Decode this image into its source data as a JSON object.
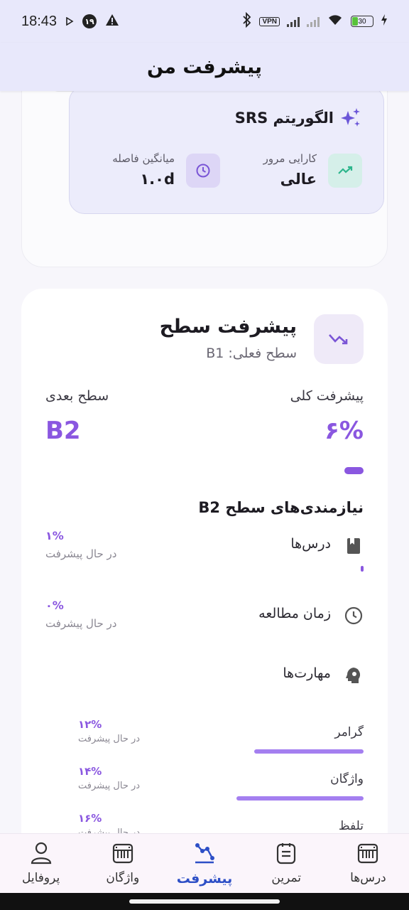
{
  "status_bar": {
    "time": "18:43",
    "notification_badge": "۱۹",
    "vpn": "VPN",
    "battery_level": "30"
  },
  "header": {
    "title": "پیشرفت من"
  },
  "srs": {
    "title": "الگوریتم SRS",
    "review_label": "کارایی مرور",
    "review_value": "عالی",
    "interval_label": "میانگین فاصله",
    "interval_value": "۱.۰d",
    "colors": {
      "review_icon": "#3bbf9a",
      "interval_icon": "#7a55d6"
    }
  },
  "level": {
    "title": "پیشرفت سطح",
    "current": "سطح فعلی: B1",
    "overall_label": "پیشرفت کلی",
    "overall_value": "۶%",
    "overall_fraction": 0.06,
    "next_label": "سطح بعدی",
    "next_value": "B2",
    "accent": "#8a57e0"
  },
  "requirements": {
    "title": "نیازمندی‌های سطح B2",
    "items": [
      {
        "name": "درس‌ها",
        "percent": "۱%",
        "state": "در حال پیشرفت",
        "fraction": 0.01,
        "icon": "book-icon"
      },
      {
        "name": "زمان مطالعه",
        "percent": "۰%",
        "state": "در حال پیشرفت",
        "fraction": 0.0,
        "icon": "clock-icon"
      }
    ],
    "skills_title": "مهارت‌ها",
    "skills": [
      {
        "name": "گرامر",
        "percent": "۱۲%",
        "state": "در حال پیشرفت",
        "fraction": 0.12
      },
      {
        "name": "واژگان",
        "percent": "۱۴%",
        "state": "در حال پیشرفت",
        "fraction": 0.14
      },
      {
        "name": "تلفظ",
        "percent": "۱۶%",
        "state": "در حال پیشرفت",
        "fraction": 0.16
      }
    ]
  },
  "bottom_nav": {
    "items": [
      {
        "label": "درس‌ها",
        "icon": "lessons-icon",
        "active": false
      },
      {
        "label": "تمرین",
        "icon": "practice-icon",
        "active": false
      },
      {
        "label": "پیشرفت",
        "icon": "progress-icon",
        "active": true
      },
      {
        "label": "واژگان",
        "icon": "vocabulary-icon",
        "active": false
      },
      {
        "label": "پروفایل",
        "icon": "profile-icon",
        "active": false
      }
    ]
  }
}
